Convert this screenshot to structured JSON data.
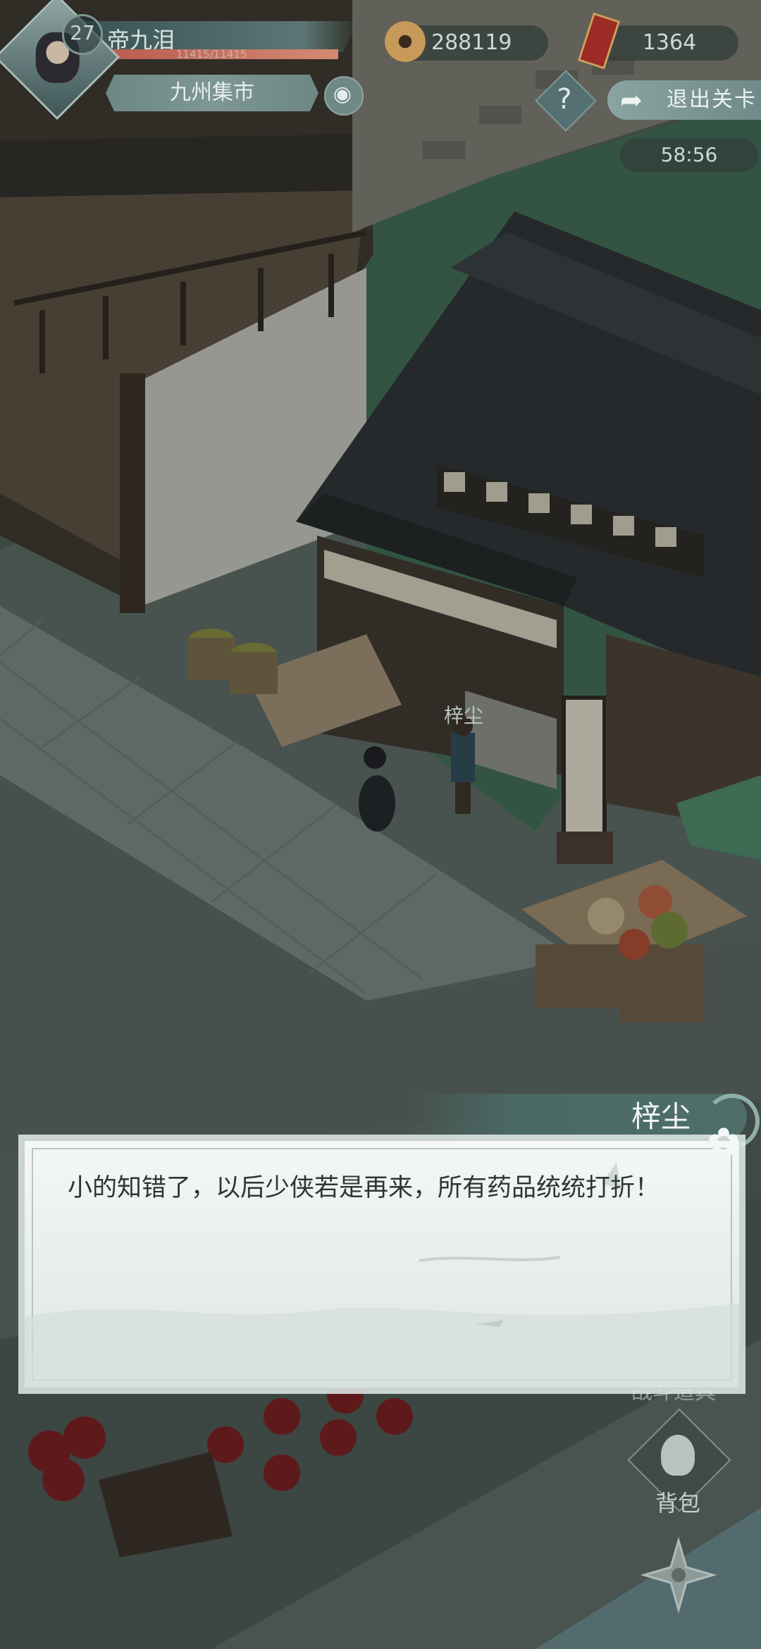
{
  "hud": {
    "player": {
      "level": "27",
      "name": "帝九泪",
      "hp_text": "11415/11415",
      "hp_fraction": 1.0
    },
    "location": "九州集市",
    "currency": {
      "coins": "288119",
      "tickets": "1364"
    },
    "help_label": "?",
    "exit_label": "退出关卡",
    "timer": "58:56"
  },
  "scene": {
    "npc_name": "梓尘"
  },
  "side_menu": {
    "battle_items_label": "战斗道具",
    "bag_label": "背包"
  },
  "dialog": {
    "speaker": "梓尘",
    "text": "小的知错了，以后少侠若是再来，所有药品统统打折！"
  },
  "colors": {
    "dialog_bg": "#eef3f2",
    "speaker_bar": "#4f6e6a",
    "hp_fill": "#c26a58"
  },
  "icons": {
    "avatar": "avatar-portrait",
    "coin": "copper-coin-icon",
    "ticket": "red-token-icon",
    "eye": "eye-icon",
    "help": "question-icon",
    "exit": "exit-arrow-icon",
    "bag": "bag-icon",
    "skill": "shuriken-icon"
  }
}
